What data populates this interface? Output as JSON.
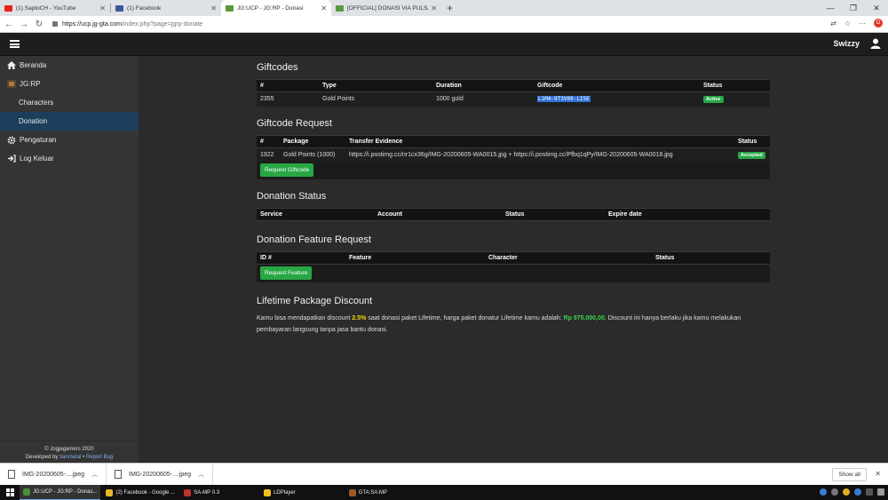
{
  "browser": {
    "tabs": [
      {
        "title": "(1) SaptoCH - YouTube",
        "favicon_color": "#e62117"
      },
      {
        "title": "(1) Facebook",
        "favicon_color": "#3b5998"
      },
      {
        "title": "JG:UCP - JG:RP - Donasi",
        "favicon_color": "#5a9a3a",
        "active": true
      },
      {
        "title": "[OFFICIAL] DONASI VIA PULSA",
        "favicon_color": "#5a9a3a"
      }
    ],
    "url_host": "https://ucp.jg-gta.com",
    "url_path": "/index.php?page=jgrp-donate"
  },
  "header": {
    "username": "Swizzy"
  },
  "sidebar": {
    "items": [
      {
        "label": "Beranda",
        "icon": "home-icon"
      },
      {
        "label": "JG:RP",
        "icon": "jgrp-logo-icon"
      },
      {
        "label": "Characters",
        "icon": ""
      },
      {
        "label": "Donation",
        "icon": ""
      },
      {
        "label": "Pengaturan",
        "icon": "gear-icon"
      },
      {
        "label": "Log Keluar",
        "icon": "signout-icon"
      }
    ],
    "footer_copyright": "© Jogjagamers 2020",
    "footer_developed": "Developed by",
    "footer_dev_name": "tianmetal",
    "footer_sep": "•",
    "footer_report": "Report Bug"
  },
  "giftcodes": {
    "title": "Giftcodes",
    "headers": [
      "#",
      "Type",
      "Duration",
      "Giftcode",
      "Status"
    ],
    "rows": [
      {
        "id": "2355",
        "type": "Gold Points",
        "duration": "1000 gold",
        "code": "L1M4-9T3V09-LISE",
        "status": "Active"
      }
    ]
  },
  "giftcode_request": {
    "title": "Giftcode Request",
    "headers": [
      "#",
      "Package",
      "Transfer Evidence",
      "Status"
    ],
    "rows": [
      {
        "id": "1922",
        "package": "Gold Points (1000)",
        "evidence": "https://i.postimg.cc/nr1cx36g/IMG-20200605-WA0015.jpg + https://i.postimg.cc/Pfbq1qPy/IMG-20200605-WA0018.jpg",
        "status": "Accepted"
      }
    ],
    "button": "Request Giftcode"
  },
  "donation_status": {
    "title": "Donation Status",
    "headers": [
      "Service",
      "Account",
      "Status",
      "Expire date"
    ]
  },
  "feature_request": {
    "title": "Donation Feature Request",
    "headers": [
      "ID #",
      "Feature",
      "Character",
      "Status"
    ],
    "button": "Request Feature"
  },
  "lifetime": {
    "title": "Lifetime Package Discount",
    "text_1": "Kamu bisa mendapatkan discount ",
    "discount": "2.5%",
    "text_2": " saat donasi paket Lifetime, harga paket donatur Lifetime kamu adalah: ",
    "price": "Rp 975.000,00.",
    "text_3": " Discount ini hanya berlaku jika kamu melakukan pembayaran langsung tanpa jasa bantu donasi."
  },
  "downloads": {
    "items": [
      "IMG-20200605-....jpeg",
      "IMG-20200605-....jpeg"
    ],
    "show_all": "Show all"
  },
  "taskbar": {
    "items": [
      {
        "label": "JG:UCP - JG:RP - Donas...",
        "color": "#4a8f3a",
        "active": true
      },
      {
        "label": "(2) Facebook - Google ...",
        "color": "#e8b52a"
      },
      {
        "label": "SA-MP 0.3",
        "color": "#c03030"
      },
      {
        "label": "LDPlayer",
        "color": "#f0c020"
      },
      {
        "label": "GTA:SA:MP",
        "color": "#a05a2a"
      }
    ]
  }
}
